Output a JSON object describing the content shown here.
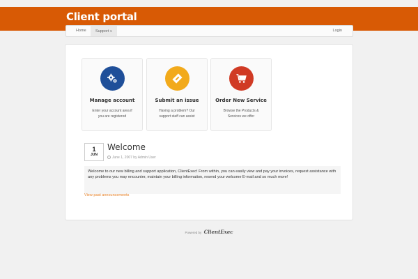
{
  "header": {
    "title": "Client portal",
    "color": "#d85a05"
  },
  "nav": {
    "home": "Home",
    "support": "Support",
    "login": "Login"
  },
  "cards": [
    {
      "title": "Manage account",
      "desc": "Enter your account area if you are registered",
      "icon": "gears-icon",
      "color": "#1f4f99"
    },
    {
      "title": "Submit an issue",
      "desc": "Having a problem? Our support staff can assist",
      "icon": "ticket-icon",
      "color": "#f2aa1b"
    },
    {
      "title": "Order New Service",
      "desc": "Browse the Products & Services we offer",
      "icon": "cart-icon",
      "color": "#d03a24"
    }
  ],
  "announcement": {
    "day": "1",
    "month": "JUN",
    "title": "Welcome",
    "meta": "June 1, 2007 by Admin User",
    "body": "Welcome to our new billing and support application, ClientExec! From within, you can easily view and pay your invoices, request assistance with any problems you may encounter, maintain your billing information, resend your welcome E-mail and so much more!"
  },
  "past_link": "View past announcements",
  "footer": {
    "powered": "Powered by",
    "brand": "ClientExec"
  }
}
